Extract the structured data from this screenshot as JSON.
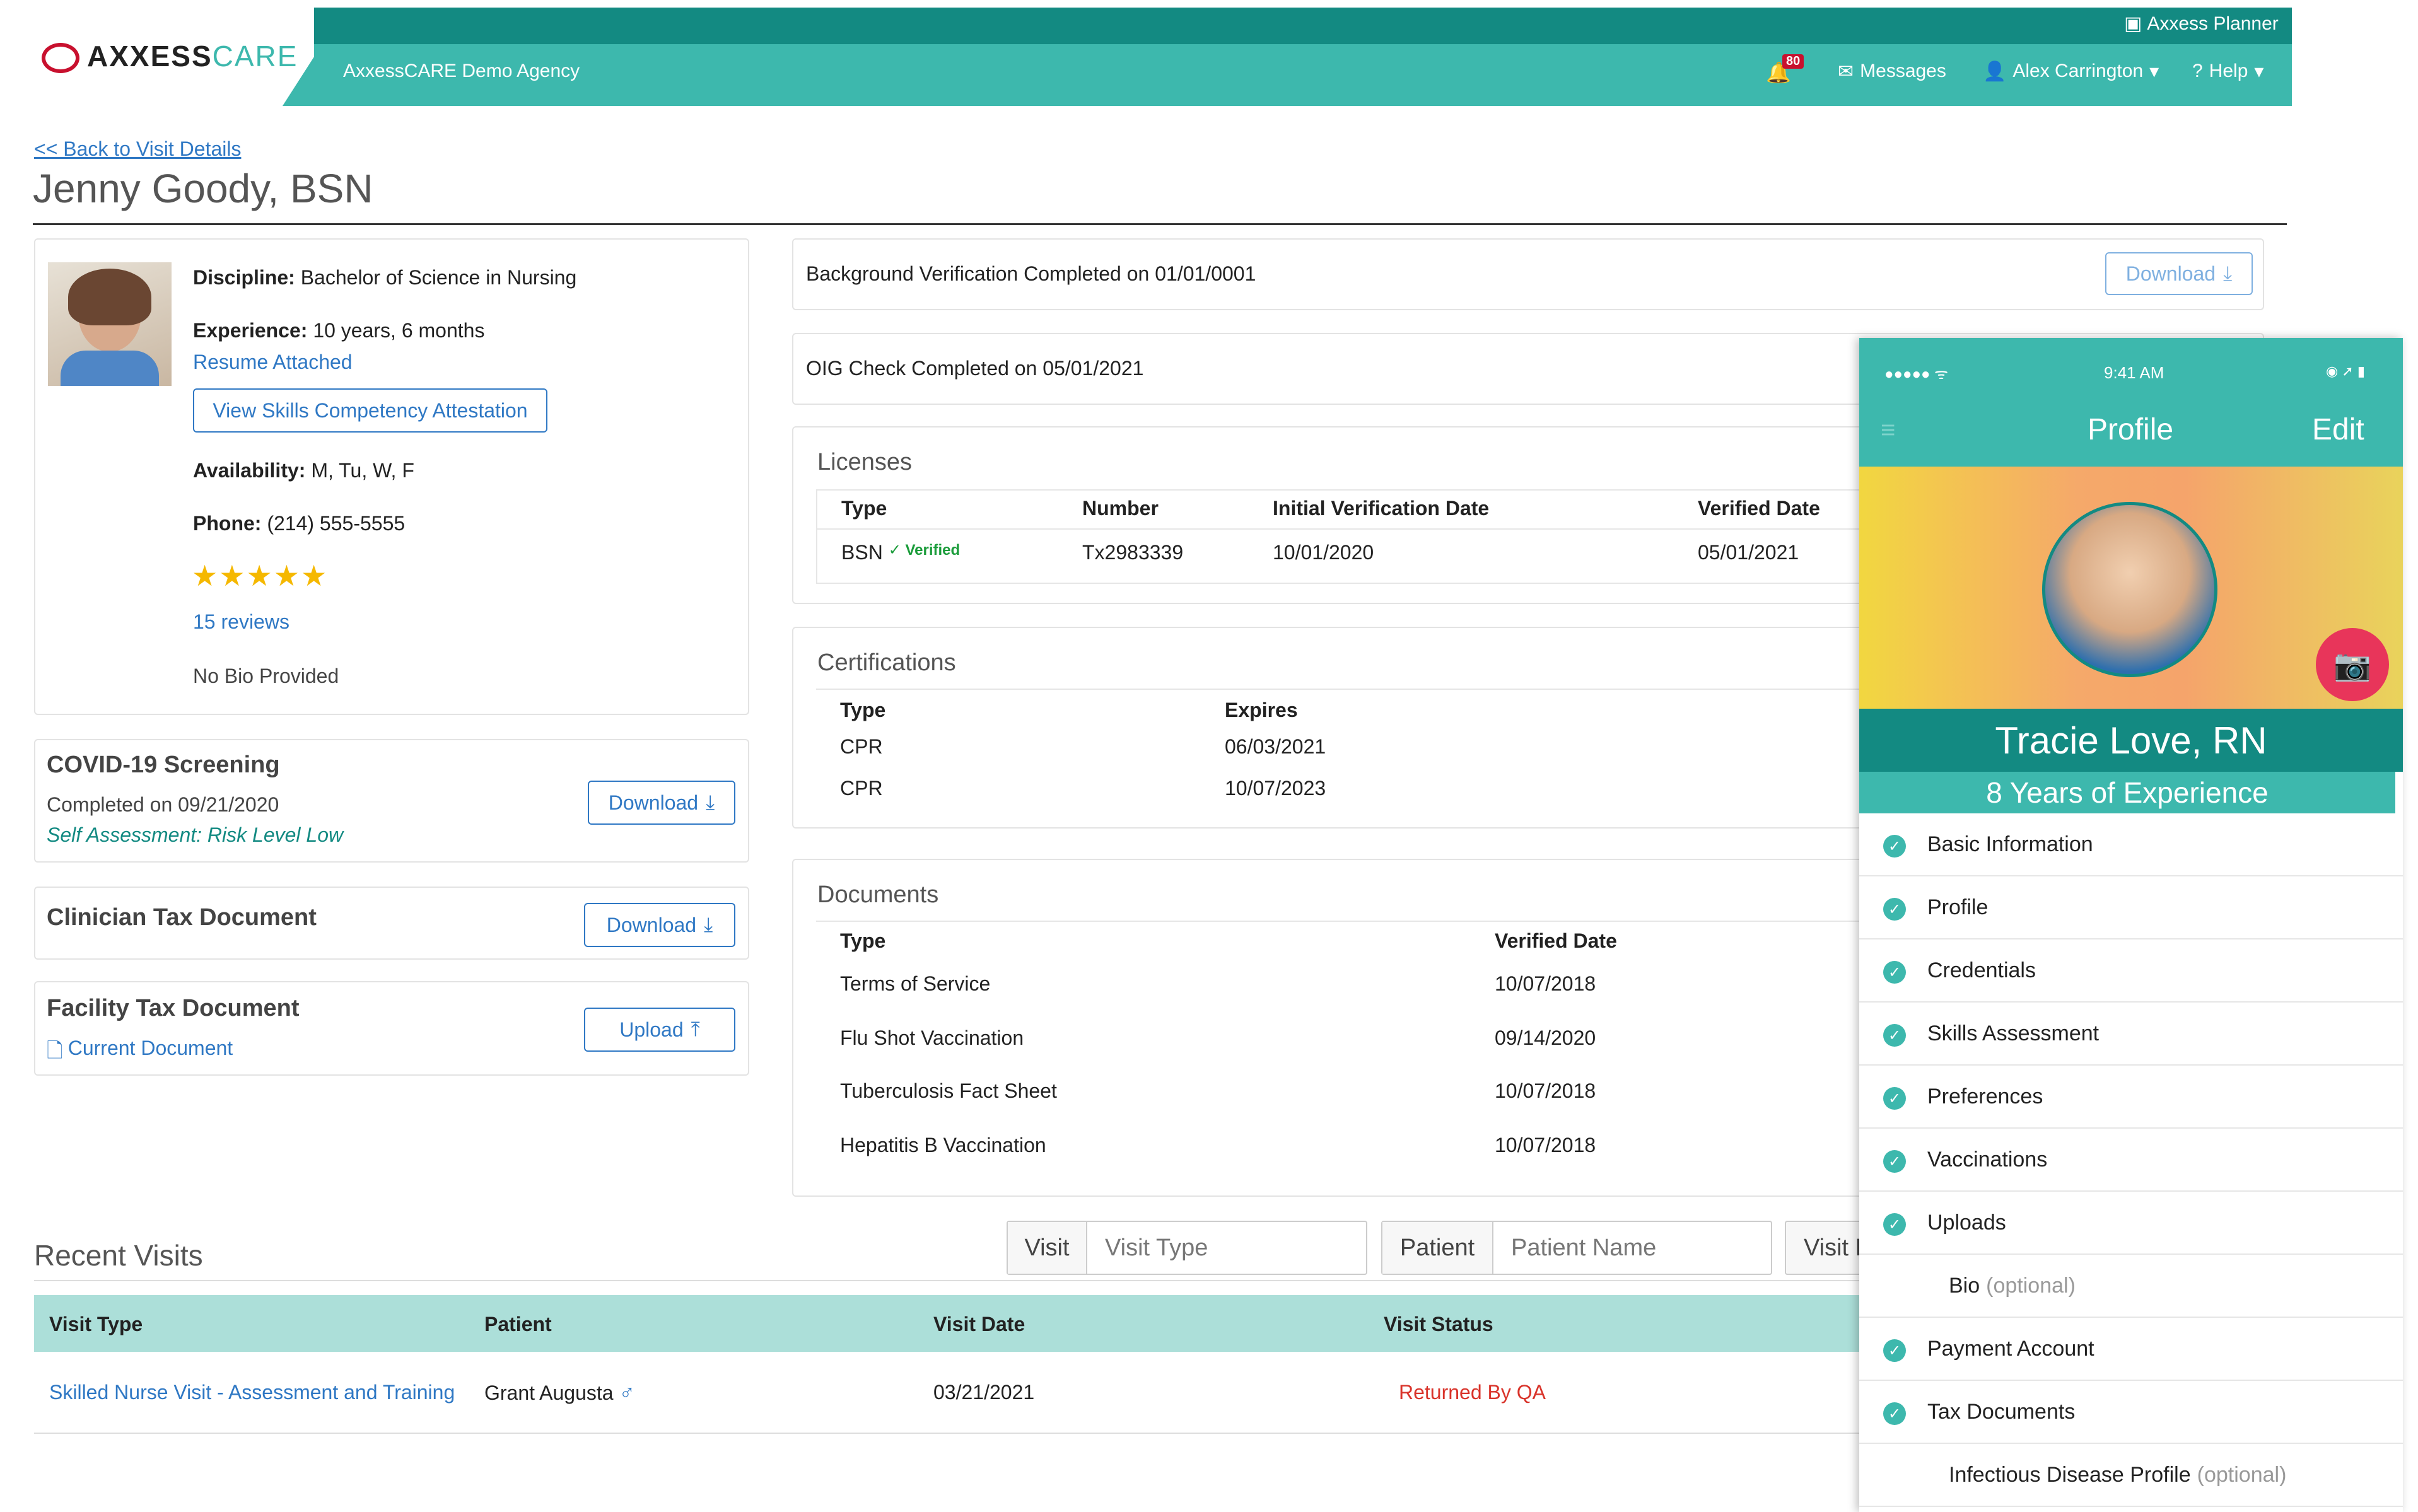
{
  "header": {
    "logo_main": "AXXESS",
    "logo_accent": "CARE",
    "agency": "AxxessCARE Demo Agency",
    "planner": "Axxess Planner",
    "notification_count": "80",
    "messages": "Messages",
    "user": "Alex Carrington",
    "help": "Help"
  },
  "page": {
    "back_link": "<< Back to Visit Details",
    "title": "Jenny Goody, BSN"
  },
  "profile": {
    "discipline_label": "Discipline:",
    "discipline_value": "Bachelor of Science in Nursing",
    "experience_label": "Experience:",
    "experience_value": "10 years, 6 months",
    "resume": "Resume Attached",
    "skills_button": "View Skills Competency Attestation",
    "availability_label": "Availability:",
    "availability_value": "M, Tu, W, F",
    "phone_label": "Phone:",
    "phone_value": "(214) 555-5555",
    "rating": 5,
    "reviews": "15 reviews",
    "bio": "No Bio Provided"
  },
  "covid": {
    "title": "COVID-19 Screening",
    "completed": "Completed on 09/21/2020",
    "assessment": "Self Assessment: Risk Level Low",
    "button": "Download"
  },
  "clinician_tax": {
    "title": "Clinician Tax Document",
    "button": "Download"
  },
  "facility_tax": {
    "title": "Facility Tax Document",
    "link": "Current Document",
    "button": "Upload"
  },
  "background": {
    "text": "Background Verification Completed on 01/01/0001",
    "button": "Download"
  },
  "oig": {
    "text": "OIG Check Completed on 05/01/2021"
  },
  "licenses": {
    "title": "Licenses",
    "headers": [
      "Type",
      "Number",
      "Initial Verification Date",
      "Verified Date"
    ],
    "rows": [
      {
        "type": "BSN",
        "verified": "Verified",
        "number": "Tx2983339",
        "initial": "10/01/2020",
        "verified_date": "05/01/2021"
      }
    ]
  },
  "certifications": {
    "title": "Certifications",
    "headers": [
      "Type",
      "Expires"
    ],
    "rows": [
      {
        "type": "CPR",
        "expires": "06/03/2021"
      },
      {
        "type": "CPR",
        "expires": "10/07/2023"
      }
    ]
  },
  "documents": {
    "title": "Documents",
    "headers": [
      "Type",
      "Verified Date"
    ],
    "rows": [
      {
        "type": "Terms of Service",
        "date": "10/07/2018"
      },
      {
        "type": "Flu Shot Vaccination",
        "date": "09/14/2020"
      },
      {
        "type": "Tuberculosis Fact Sheet",
        "date": "10/07/2018"
      },
      {
        "type": "Hepatitis B Vaccination",
        "date": "10/07/2018"
      }
    ]
  },
  "recent_visits": {
    "title": "Recent Visits",
    "filter_visit_label": "Visit",
    "filter_visit_placeholder": "Visit Type",
    "filter_patient_label": "Patient",
    "filter_patient_placeholder": "Patient Name",
    "filter_visit_date_label": "Visit D",
    "headers": [
      "Visit Type",
      "Patient",
      "Visit Date",
      "Visit Status"
    ],
    "rows": [
      {
        "visit_type": "Skilled Nurse Visit - Assessment and Training",
        "patient": "Grant Augusta",
        "date": "03/21/2021",
        "status": "Returned By QA"
      }
    ]
  },
  "phone": {
    "time": "9:41 AM",
    "title": "Profile",
    "edit": "Edit",
    "name": "Tracie Love, RN",
    "experience": "8 Years of Experience",
    "items": [
      {
        "label": "Basic Information",
        "check": true,
        "optional": ""
      },
      {
        "label": "Profile",
        "check": true,
        "optional": ""
      },
      {
        "label": "Credentials",
        "check": true,
        "optional": ""
      },
      {
        "label": "Skills Assessment",
        "check": true,
        "optional": ""
      },
      {
        "label": "Preferences",
        "check": true,
        "optional": ""
      },
      {
        "label": "Vaccinations",
        "check": true,
        "optional": ""
      },
      {
        "label": "Uploads",
        "check": true,
        "optional": ""
      },
      {
        "label": "Bio",
        "check": false,
        "optional": "(optional)"
      },
      {
        "label": "Payment Account",
        "check": true,
        "optional": ""
      },
      {
        "label": "Tax Documents",
        "check": true,
        "optional": ""
      },
      {
        "label": "Infectious Disease Profile",
        "check": false,
        "optional": "(optional)"
      }
    ]
  },
  "colors": {
    "teal": "#3db8ad",
    "dark_teal": "#138a82",
    "link_blue": "#2f78c4",
    "status_red": "#d9342b",
    "star_gold": "#f5b800"
  }
}
